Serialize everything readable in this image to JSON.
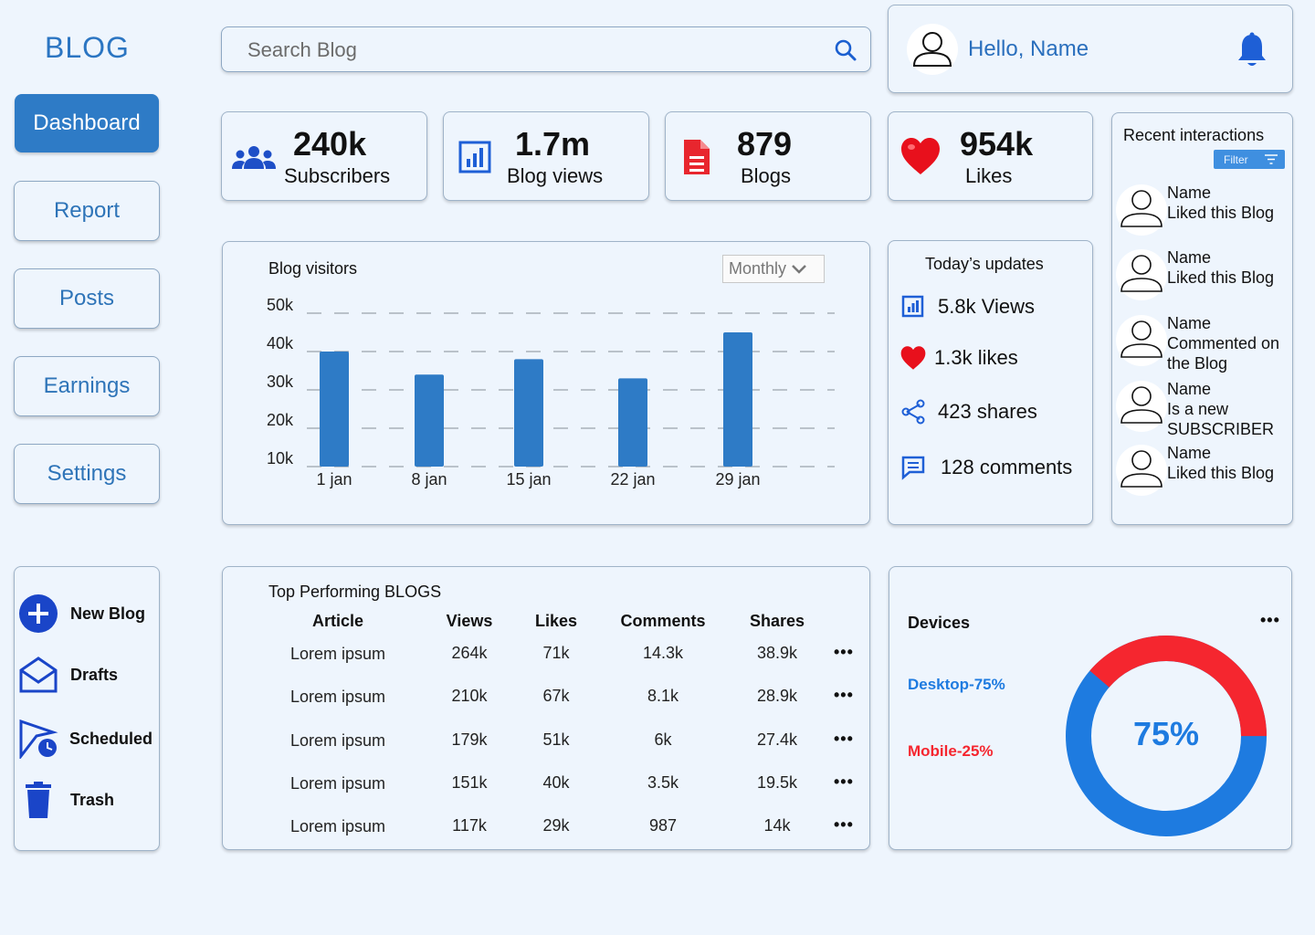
{
  "brand": "BLOG",
  "nav": [
    "Dashboard",
    "Report",
    "Posts",
    "Earnings",
    "Settings"
  ],
  "search": {
    "placeholder": "Search Blog"
  },
  "user": {
    "greeting": "Hello, Name"
  },
  "stats": [
    {
      "value": "240k",
      "label": "Subscribers",
      "icon": "users-icon"
    },
    {
      "value": "1.7m",
      "label": "Blog views",
      "icon": "bar-chart-icon"
    },
    {
      "value": "879",
      "label": "Blogs",
      "icon": "document-icon"
    },
    {
      "value": "954k",
      "label": "Likes",
      "icon": "heart-icon"
    }
  ],
  "visitors": {
    "title": "Blog visitors",
    "period": "Monthly"
  },
  "chart_data": {
    "type": "bar",
    "title": "Blog visitors",
    "categories": [
      "1 jan",
      "8 jan",
      "15 jan",
      "22 jan",
      "29 jan"
    ],
    "values": [
      40,
      34,
      38,
      33,
      45
    ],
    "y_ticks": [
      "10k",
      "20k",
      "30k",
      "40k",
      "50k"
    ],
    "ylim": [
      10,
      50
    ],
    "grid": "dashed-horizontal",
    "bar_color": "#2e7bc6"
  },
  "updates": {
    "title": "Today’s updates",
    "items": [
      {
        "text": "5.8k Views",
        "icon": "bar-chart-icon"
      },
      {
        "text": "1.3k likes",
        "icon": "heart-icon"
      },
      {
        "text": "423 shares",
        "icon": "share-icon"
      },
      {
        "text": "128 comments",
        "icon": "comment-icon"
      }
    ]
  },
  "interactions": {
    "title": "Recent interactions",
    "filter": "Filter",
    "items": [
      {
        "name": "Name",
        "action": "Liked this Blog"
      },
      {
        "name": "Name",
        "action": "Liked this Blog"
      },
      {
        "name": "Name",
        "action": "Commented on the  Blog"
      },
      {
        "name": "Name",
        "action": "Is a new SUBSCRIBER"
      },
      {
        "name": "Name",
        "action": "Liked this Blog"
      }
    ]
  },
  "quick": [
    "New Blog",
    "Drafts",
    "Scheduled",
    "Trash"
  ],
  "top": {
    "title": "Top Performing BLOGS",
    "headers": [
      "Article",
      "Views",
      "Likes",
      "Comments",
      "Shares"
    ],
    "rows": [
      [
        "Lorem ipsum",
        "264k",
        "71k",
        "14.3k",
        "38.9k"
      ],
      [
        "Lorem ipsum",
        "210k",
        "67k",
        "8.1k",
        "28.9k"
      ],
      [
        "Lorem ipsum",
        "179k",
        "51k",
        "6k",
        "27.4k"
      ],
      [
        "Lorem ipsum",
        "151k",
        "40k",
        "3.5k",
        "19.5k"
      ],
      [
        "Lorem ipsum",
        "117k",
        "29k",
        "987",
        "14k"
      ]
    ]
  },
  "devices": {
    "title": "Devices",
    "desktop_label": "Desktop-75%",
    "mobile_label": "Mobile-25%",
    "center": "75%",
    "desktop_pct": 75,
    "mobile_pct": 25,
    "colors": {
      "desktop": "#1e7be0",
      "mobile": "#f5262f"
    }
  }
}
